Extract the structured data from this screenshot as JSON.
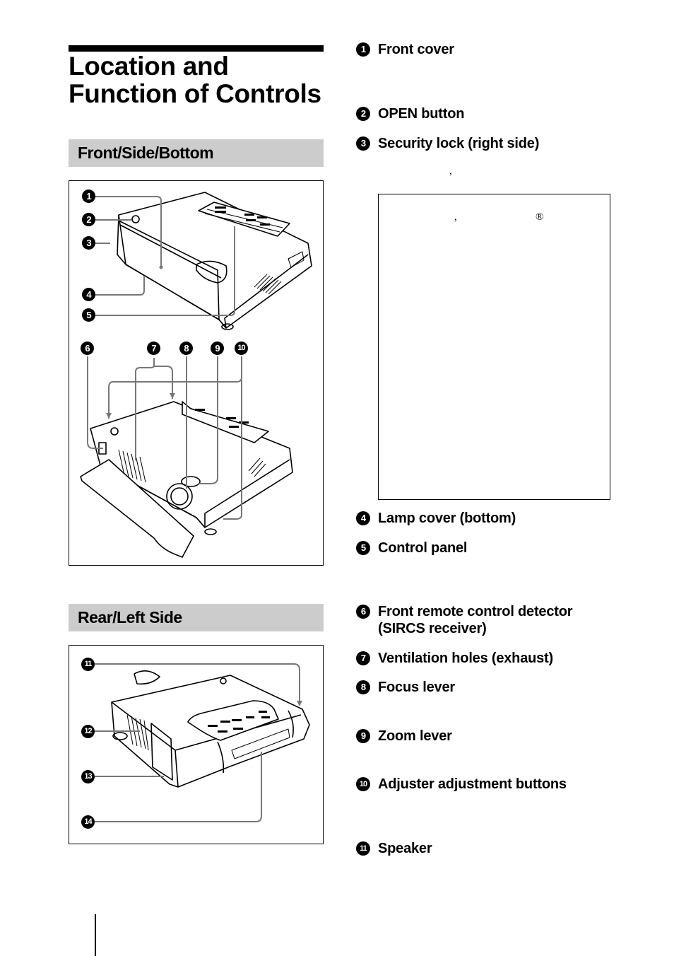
{
  "page": {
    "title_line1": "Location and",
    "title_line2": "Function of Controls"
  },
  "sections": [
    {
      "heading": "Front/Side/Bottom"
    },
    {
      "heading": "Rear/Left Side"
    }
  ],
  "figure_front": {
    "callouts_top": [
      "1",
      "2",
      "3",
      "4",
      "5"
    ],
    "callouts_mid": [
      "6",
      "7",
      "8",
      "9",
      "10"
    ]
  },
  "figure_rear": {
    "callouts": [
      "11",
      "12",
      "13",
      "14"
    ]
  },
  "items": [
    {
      "num": "1",
      "label": "Front cover"
    },
    {
      "num": "2",
      "label": "OPEN button"
    },
    {
      "num": "3",
      "label": "Security lock (right side)"
    },
    {
      "num": "4",
      "label": "Lamp cover (bottom)"
    },
    {
      "num": "5",
      "label": "Control panel"
    },
    {
      "num": "6",
      "label": "Front remote control detector",
      "label2": "(SIRCS receiver)"
    },
    {
      "num": "7",
      "label": "Ventilation holes (exhaust)"
    },
    {
      "num": "8",
      "label": "Focus lever"
    },
    {
      "num": "9",
      "label": "Zoom lever"
    },
    {
      "num": "10",
      "label": "Adjuster adjustment buttons"
    },
    {
      "num": "11",
      "label": "Speaker"
    }
  ],
  "stray_marks": {
    "comma": ",",
    "note_comma": ",",
    "registered": "®"
  },
  "colors": {
    "section_bar": "#cccccc",
    "leader_line": "#777777",
    "ink": "#000000"
  }
}
